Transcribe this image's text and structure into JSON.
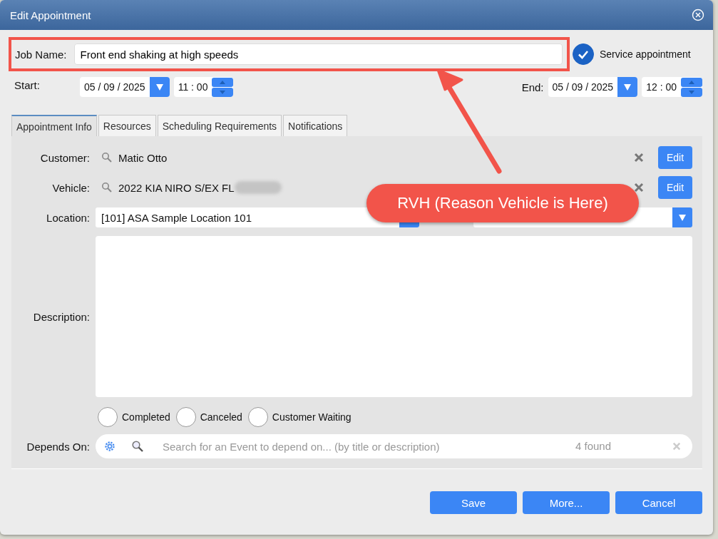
{
  "window": {
    "title": "Edit Appointment"
  },
  "job_name": {
    "label": "Job Name:",
    "value": "Front end shaking at high speeds"
  },
  "service_appointment": {
    "label": "Service appointment",
    "checked": true
  },
  "start": {
    "label": "Start:",
    "date": "05 / 09 / 2025",
    "time": "11 : 00"
  },
  "end": {
    "label": "End:",
    "date": "05 / 09 / 2025",
    "time": "12 : 00"
  },
  "tabs": [
    {
      "label": "Appointment Info",
      "selected": true
    },
    {
      "label": "Resources",
      "selected": false
    },
    {
      "label": "Scheduling Requirements",
      "selected": false
    },
    {
      "label": "Notifications",
      "selected": false
    }
  ],
  "customer": {
    "label": "Customer:",
    "value": "Matic Otto",
    "button": "Edit"
  },
  "vehicle": {
    "label": "Vehicle:",
    "value": "2022 KIA NIRO S/EX FL",
    "button": "Edit"
  },
  "location": {
    "label": "Location:",
    "value": "[101] ASA Sample Location 101"
  },
  "description": {
    "label": "Description:"
  },
  "flags": [
    {
      "label": "Completed",
      "checked": false
    },
    {
      "label": "Canceled",
      "checked": false
    },
    {
      "label": "Customer Waiting",
      "checked": false
    }
  ],
  "depends_on": {
    "label": "Depends On:",
    "placeholder": "Search for an Event to depend on... (by title or description)",
    "count": "4 found"
  },
  "buttons": [
    "Save",
    "More...",
    "Cancel"
  ],
  "annotation": {
    "callout": "RVH (Reason Vehicle is Here)"
  }
}
